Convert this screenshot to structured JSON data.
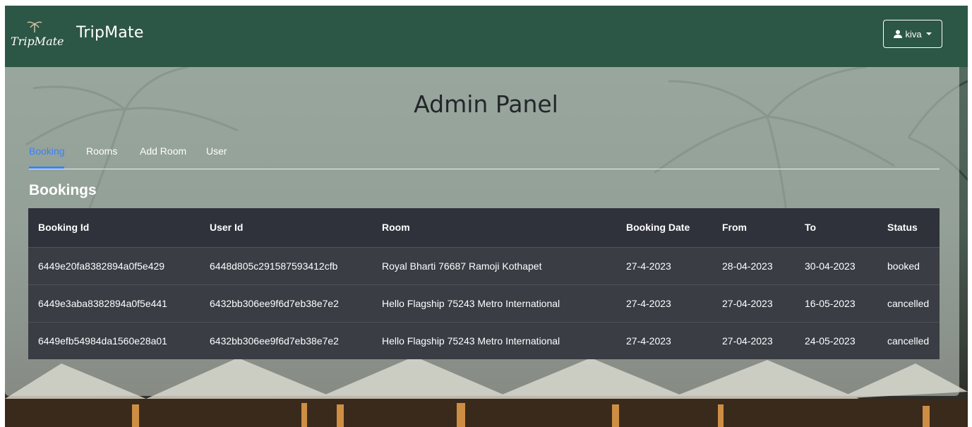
{
  "brand": {
    "logo_text": "TripMate",
    "name": "TripMate"
  },
  "user_menu": {
    "icon": "user-icon",
    "username": "kiva"
  },
  "panel": {
    "title": "Admin Panel",
    "tabs": [
      {
        "label": "Booking",
        "active": true
      },
      {
        "label": "Rooms",
        "active": false
      },
      {
        "label": "Add Room",
        "active": false
      },
      {
        "label": "User",
        "active": false
      }
    ],
    "section_title": "Bookings"
  },
  "bookings": {
    "columns": [
      "Booking Id",
      "User Id",
      "Room",
      "Booking Date",
      "From",
      "To",
      "Status"
    ],
    "rows": [
      [
        "6449e20fa8382894a0f5e429",
        "6448d805c291587593412cfb",
        "Royal Bharti 76687 Ramoji Kothapet",
        "27-4-2023",
        "28-04-2023",
        "30-04-2023",
        "booked"
      ],
      [
        "6449e3aba8382894a0f5e441",
        "6432bb306ee9f6d7eb38e7e2",
        "Hello Flagship 75243 Metro International",
        "27-4-2023",
        "27-04-2023",
        "16-05-2023",
        "cancelled"
      ],
      [
        "6449efb54984da1560e28a01",
        "6432bb306ee9f6d7eb38e7e2",
        "Hello Flagship 75243 Metro International",
        "27-4-2023",
        "27-04-2023",
        "24-05-2023",
        "cancelled"
      ]
    ]
  },
  "colors": {
    "navbar": "#2c5646",
    "active_tab": "#3b82f6",
    "table_header": "#2f323a",
    "table_row": "#3a3d44"
  }
}
